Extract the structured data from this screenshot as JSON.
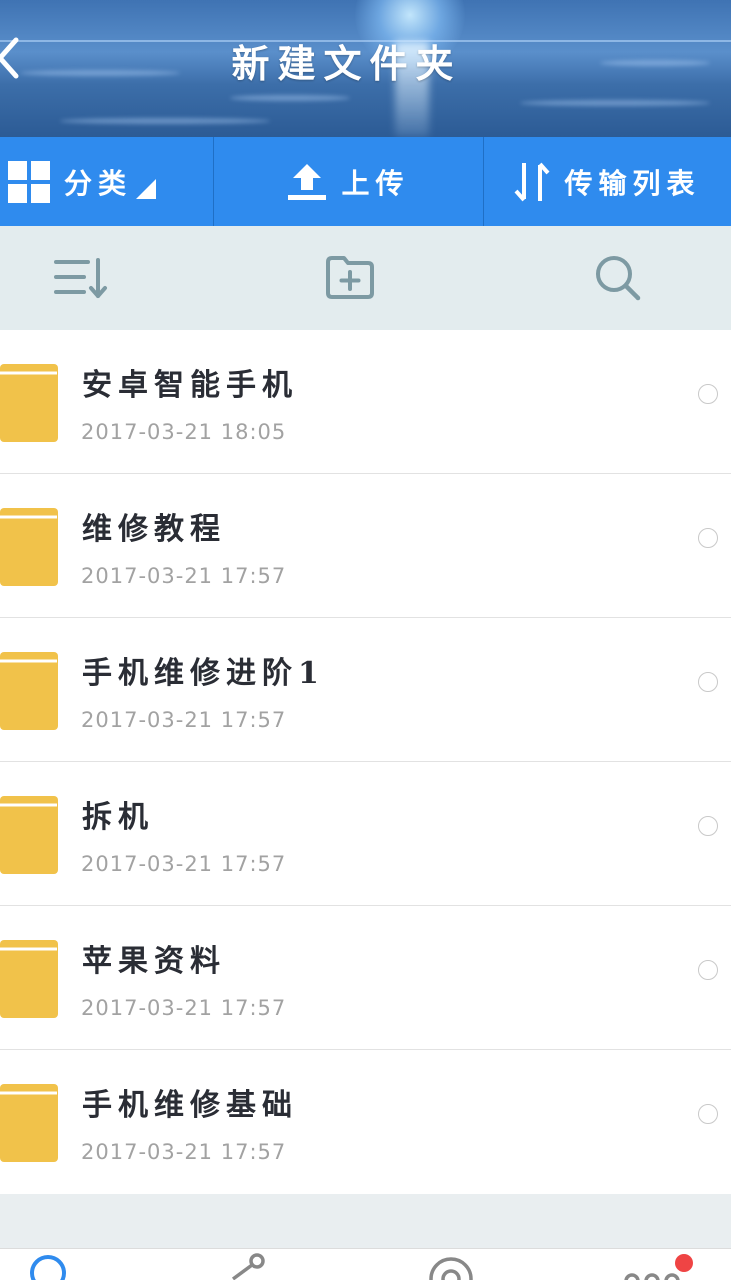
{
  "header": {
    "title": "新建文件夹",
    "back_icon": "chevron-left-icon"
  },
  "toolbar": {
    "category_label": "分类",
    "upload_label": "上传",
    "transfer_label": "传输列表"
  },
  "actionbar": {
    "icons": [
      "sort-icon",
      "new-folder-icon",
      "search-icon"
    ]
  },
  "files": [
    {
      "name": "安卓智能手机",
      "date": "2017-03-21  18:05"
    },
    {
      "name": "维修教程",
      "date": "2017-03-21  17:57"
    },
    {
      "name": "手机维修进阶1",
      "date": "2017-03-21  17:57"
    },
    {
      "name": "拆机",
      "date": "2017-03-21  17:57"
    },
    {
      "name": "苹果资料",
      "date": "2017-03-21  17:57"
    },
    {
      "name": "手机维修基础",
      "date": "2017-03-21  17:57"
    }
  ],
  "bottom_nav": {
    "icons": [
      "home-icon",
      "share-icon",
      "discover-icon",
      "more-icon"
    ]
  },
  "colors": {
    "toolbar_blue": "#2f8bee",
    "folder_yellow": "#f1c24a",
    "notification_red": "#ef4444"
  }
}
